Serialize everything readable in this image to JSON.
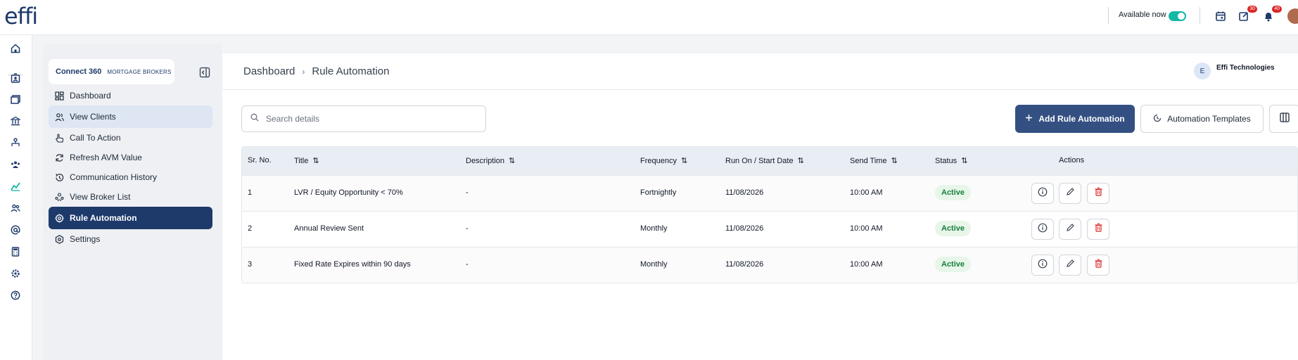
{
  "app": {
    "logo": "effi"
  },
  "topbar": {
    "availability_label": "Available now",
    "badges": {
      "tasks": "30",
      "notifications": "40"
    }
  },
  "rail": {
    "icons": [
      "home-icon",
      "contact-card-icon",
      "folder-icon",
      "bank-icon",
      "hierarchy-icon",
      "team-icon",
      "chart-icon",
      "users-icon",
      "at-icon",
      "calculator-icon",
      "settings-gear-icon",
      "help-icon"
    ]
  },
  "brand": {
    "name": "Connect 360",
    "suffix": "MORTGAGE BROKERS"
  },
  "sidebar": {
    "items": [
      {
        "label": "Dashboard",
        "icon": "dashboard-icon"
      },
      {
        "label": "View Clients",
        "icon": "clients-icon"
      },
      {
        "label": "Call To Action",
        "icon": "hand-pointer-icon"
      },
      {
        "label": "Refresh AVM Value",
        "icon": "refresh-icon"
      },
      {
        "label": "Communication History",
        "icon": "history-icon"
      },
      {
        "label": "View Broker List",
        "icon": "broker-icon"
      },
      {
        "label": "Rule Automation",
        "icon": "automation-icon"
      },
      {
        "label": "Settings",
        "icon": "settings-icon"
      }
    ],
    "active": "Rule Automation"
  },
  "breadcrumb": {
    "root": "Dashboard",
    "current": "Rule Automation"
  },
  "user": {
    "initial": "E",
    "name": "Effi Technologies"
  },
  "search": {
    "placeholder": "Search details"
  },
  "toolbar": {
    "add_label": "Add Rule Automation",
    "templates_label": "Automation Templates"
  },
  "table": {
    "headers": {
      "sr": "Sr. No.",
      "title": "Title",
      "description": "Description",
      "frequency": "Frequency",
      "run_on": "Run On / Start Date",
      "send_time": "Send Time",
      "status": "Status",
      "actions": "Actions"
    },
    "rows": [
      {
        "sr": "1",
        "title": "LVR / Equity Opportunity < 70%",
        "description": "-",
        "frequency": "Fortnightly",
        "run_on": "11/08/2026",
        "send_time": "10:00 AM",
        "status": "Active"
      },
      {
        "sr": "2",
        "title": "Annual Review Sent",
        "description": "-",
        "frequency": "Monthly",
        "run_on": "11/08/2026",
        "send_time": "10:00 AM",
        "status": "Active"
      },
      {
        "sr": "3",
        "title": "Fixed Rate Expires within 90 days",
        "description": "-",
        "frequency": "Monthly",
        "run_on": "11/08/2026",
        "send_time": "10:00 AM",
        "status": "Active"
      }
    ]
  },
  "colors": {
    "primary": "#1e3a6b",
    "button": "#345083",
    "toggle": "#14b8a6",
    "status_active": "#15803d",
    "danger": "#dc2626"
  }
}
